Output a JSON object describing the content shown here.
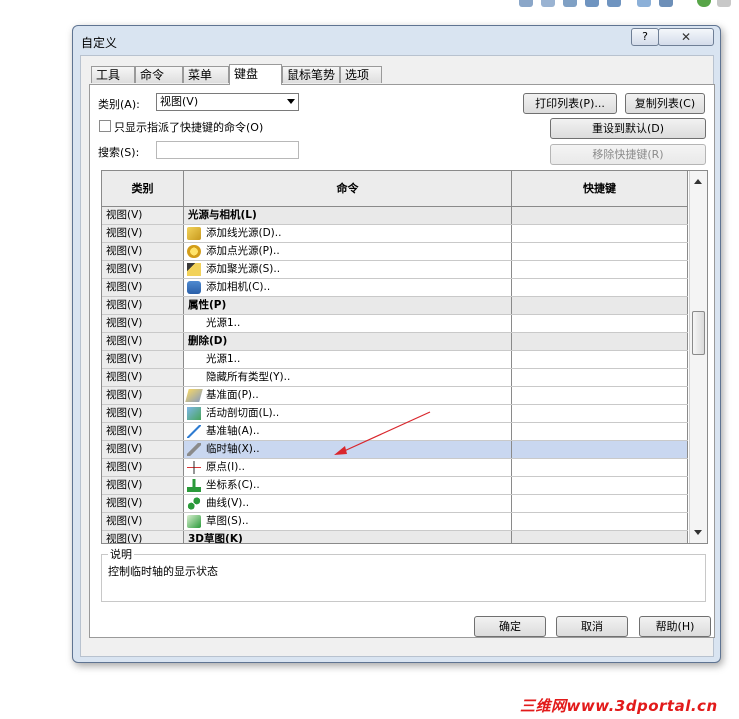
{
  "window": {
    "title": "自定义",
    "help_label": "?",
    "close_label": "✕"
  },
  "tabs": [
    {
      "label": "工具栏"
    },
    {
      "label": "命令"
    },
    {
      "label": "菜单"
    },
    {
      "label": "键盘",
      "active": true
    },
    {
      "label": "鼠标笔势"
    },
    {
      "label": "选项"
    }
  ],
  "filters": {
    "category_label": "类别(A):",
    "category_value": "视图(V)",
    "only_assigned_label": "只显示指派了快捷键的命令(O)",
    "only_assigned_checked": false,
    "search_label": "搜索(S):",
    "search_value": ""
  },
  "buttons": {
    "print_list": "打印列表(P)...",
    "copy_list": "复制列表(C)",
    "reset_default": "重设到默认(D)",
    "remove_shortcut": "移除快捷键(R)",
    "ok": "确定",
    "cancel": "取消",
    "help": "帮助(H)"
  },
  "table": {
    "columns": [
      "类别",
      "命令",
      "快捷键"
    ],
    "rows": [
      {
        "category": "视图(V)",
        "command": "光源与相机(L)",
        "shortcut": "",
        "type": "section"
      },
      {
        "category": "视图(V)",
        "command": "添加线光源(D)..",
        "shortcut": "",
        "icon": "directional-light-icon"
      },
      {
        "category": "视图(V)",
        "command": "添加点光源(P)..",
        "shortcut": "",
        "icon": "point-light-icon"
      },
      {
        "category": "视图(V)",
        "command": "添加聚光源(S)..",
        "shortcut": "",
        "icon": "spot-light-icon"
      },
      {
        "category": "视图(V)",
        "command": "添加相机(C)..",
        "shortcut": "",
        "icon": "camera-icon"
      },
      {
        "category": "视图(V)",
        "command": "属性(P)",
        "shortcut": "",
        "type": "section"
      },
      {
        "category": "视图(V)",
        "command": "光源1..",
        "shortcut": ""
      },
      {
        "category": "视图(V)",
        "command": "删除(D)",
        "shortcut": "",
        "type": "section"
      },
      {
        "category": "视图(V)",
        "command": "光源1..",
        "shortcut": ""
      },
      {
        "category": "视图(V)",
        "command": "隐藏所有类型(Y)..",
        "shortcut": ""
      },
      {
        "category": "视图(V)",
        "command": "基准面(P)..",
        "shortcut": "",
        "icon": "plane-icon"
      },
      {
        "category": "视图(V)",
        "command": "活动剖切面(L)..",
        "shortcut": "",
        "icon": "section-plane-icon"
      },
      {
        "category": "视图(V)",
        "command": "基准轴(A)..",
        "shortcut": "",
        "icon": "axis-icon"
      },
      {
        "category": "视图(V)",
        "command": "临时轴(X)..",
        "shortcut": "",
        "icon": "temporary-axis-icon",
        "highlight": true
      },
      {
        "category": "视图(V)",
        "command": "原点(I)..",
        "shortcut": "",
        "icon": "origin-icon"
      },
      {
        "category": "视图(V)",
        "command": "坐标系(C)..",
        "shortcut": "",
        "icon": "coordinate-system-icon"
      },
      {
        "category": "视图(V)",
        "command": "曲线(V)..",
        "shortcut": "",
        "icon": "curve-icon"
      },
      {
        "category": "视图(V)",
        "command": "草图(S)..",
        "shortcut": "",
        "icon": "sketch-icon"
      },
      {
        "category": "视图(V)",
        "command": "3D草图(K)",
        "shortcut": "",
        "type": "section"
      }
    ]
  },
  "description": {
    "label": "说明",
    "text": "控制临时轴的显示状态"
  },
  "watermark": "三维网www.3dportal.cn",
  "colors": {
    "highlight_row": "#c9d7f0",
    "annotation_arrow": "#d9262c",
    "watermark": "#e21a1a"
  }
}
